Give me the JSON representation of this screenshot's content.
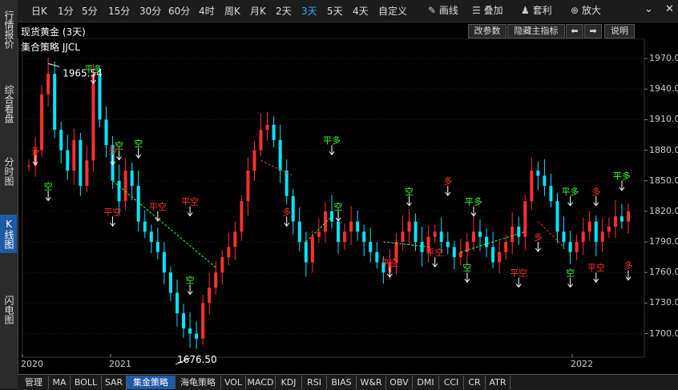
{
  "sidebar": [
    {
      "label": "行情报价",
      "active": false
    },
    {
      "label": "综合看盘",
      "active": false
    },
    {
      "label": "分时图",
      "active": false
    },
    {
      "label": "K线图",
      "active": true
    },
    {
      "label": "闪电图",
      "active": false
    }
  ],
  "toolbar": {
    "periods": [
      "日K",
      "1分",
      "5分",
      "15分",
      "30分",
      "60分",
      "4时",
      "周K",
      "月K",
      "2天",
      "3天",
      "5天",
      "4天",
      "自定义"
    ],
    "active_period": "3天",
    "tools": [
      {
        "icon": "pen-icon",
        "label": "画线"
      },
      {
        "icon": "stack-icon",
        "label": "叠加"
      },
      {
        "icon": "money-bag-icon",
        "label": "套利"
      },
      {
        "icon": "zoom-in-icon",
        "label": "放大"
      }
    ]
  },
  "header": {
    "title": "现货黄金 (3天)",
    "strategy": "集合策略 JJCL",
    "buttons": {
      "params": "改参数",
      "hide": "隐藏主指标",
      "help": "说明"
    }
  },
  "chart_data": {
    "type": "candlestick",
    "y_ticks": [
      "1970.00",
      "1940.00",
      "1910.00",
      "1880.00",
      "1850.00",
      "1820.00",
      "1790.00",
      "1760.00",
      "1730.00",
      "1700.00"
    ],
    "ylim": [
      1680,
      1985
    ],
    "x_ticks": [
      "2020",
      "2021",
      "2022"
    ],
    "high_label": "1965.54",
    "low_label": "1676.50",
    "up_color": "#ff3030",
    "down_color": "#00e5ff",
    "signals": [
      {
        "text": "平多",
        "color": "#3cff3c",
        "index": 10,
        "price": 1955
      },
      {
        "text": "空",
        "color": "#3cff3c",
        "index": 14,
        "price": 1880
      },
      {
        "text": "空",
        "color": "#3cff3c",
        "index": 17,
        "price": 1882
      },
      {
        "text": "平空",
        "color": "#ff3030",
        "index": 25,
        "price": 1825
      },
      {
        "text": "空",
        "color": "#3cff3c",
        "index": 3,
        "price": 1840
      },
      {
        "text": "平空",
        "color": "#ff3030",
        "index": 13,
        "price": 1815
      },
      {
        "text": "多",
        "color": "#ff3030",
        "index": 40,
        "price": 1815
      },
      {
        "text": "平多",
        "color": "#3cff3c",
        "index": 47,
        "price": 1885
      },
      {
        "text": "空",
        "color": "#3cff3c",
        "index": 48,
        "price": 1820
      },
      {
        "text": "平空",
        "color": "#ff3030",
        "index": 56,
        "price": 1765
      },
      {
        "text": "空",
        "color": "#3cff3c",
        "index": 59,
        "price": 1835
      },
      {
        "text": "多",
        "color": "#ff3030",
        "index": 65,
        "price": 1845
      },
      {
        "text": "平空",
        "color": "#ff3030",
        "index": 63,
        "price": 1775
      },
      {
        "text": "平多",
        "color": "#3cff3c",
        "index": 69,
        "price": 1825
      },
      {
        "text": "空",
        "color": "#3cff3c",
        "index": 68,
        "price": 1760
      },
      {
        "text": "平空",
        "color": "#ff3030",
        "index": 76,
        "price": 1755
      },
      {
        "text": "多",
        "color": "#ff3030",
        "index": 79,
        "price": 1790
      },
      {
        "text": "空",
        "color": "#3cff3c",
        "index": 84,
        "price": 1755
      },
      {
        "text": "平多",
        "color": "#3cff3c",
        "index": 84,
        "price": 1835
      },
      {
        "text": "多",
        "color": "#ff3030",
        "index": 88,
        "price": 1835
      },
      {
        "text": "平空",
        "color": "#ff3030",
        "index": 88,
        "price": 1760
      },
      {
        "text": "平多",
        "color": "#3cff3c",
        "index": 92,
        "price": 1850
      },
      {
        "text": "多",
        "color": "#ff3030",
        "index": 93,
        "price": 1762
      },
      {
        "text": "空",
        "color": "#3cff3c",
        "index": 25,
        "price": 1748
      },
      {
        "text": "多",
        "color": "#ff3030",
        "index": 1,
        "price": 1875
      },
      {
        "text": "多",
        "color": "#ff3030",
        "index": 13,
        "price": 1875
      },
      {
        "text": "平空",
        "color": "#ff3030",
        "index": 20,
        "price": 1820
      }
    ]
  },
  "bottom_tabs": [
    "管理",
    "MA",
    "BOLL",
    "SAR",
    "集金策略",
    "海龟策略",
    "VOL",
    "MACD",
    "KDJ",
    "RSI",
    "BIAS",
    "W&R",
    "OBV",
    "DMI",
    "CCI",
    "CR",
    "ATR"
  ],
  "bottom_active": "集金策略"
}
